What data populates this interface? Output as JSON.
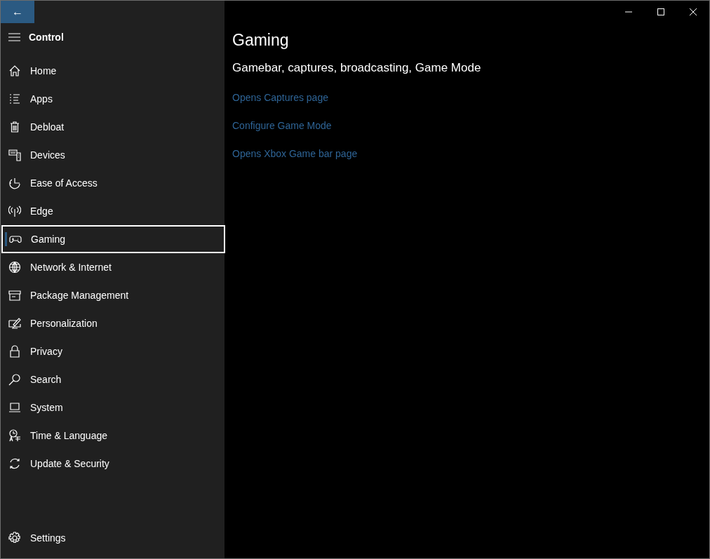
{
  "sidebar": {
    "back_button": "←",
    "title": "Control",
    "items": [
      {
        "label": "Home",
        "selected": false
      },
      {
        "label": "Apps",
        "selected": false
      },
      {
        "label": "Debloat",
        "selected": false
      },
      {
        "label": "Devices",
        "selected": false
      },
      {
        "label": "Ease of Access",
        "selected": false
      },
      {
        "label": "Edge",
        "selected": false
      },
      {
        "label": "Gaming",
        "selected": true
      },
      {
        "label": "Network & Internet",
        "selected": false
      },
      {
        "label": "Package Management",
        "selected": false
      },
      {
        "label": "Personalization",
        "selected": false
      },
      {
        "label": "Privacy",
        "selected": false
      },
      {
        "label": "Search",
        "selected": false
      },
      {
        "label": "System",
        "selected": false
      },
      {
        "label": "Time & Language",
        "selected": false
      },
      {
        "label": "Update & Security",
        "selected": false
      }
    ],
    "footer_item": {
      "label": "Settings"
    }
  },
  "content": {
    "title": "Gaming",
    "subtitle": "Gamebar, captures, broadcasting, Game Mode",
    "links": [
      "Opens Captures page",
      "Configure Game Mode",
      "Opens Xbox Game bar page"
    ]
  }
}
